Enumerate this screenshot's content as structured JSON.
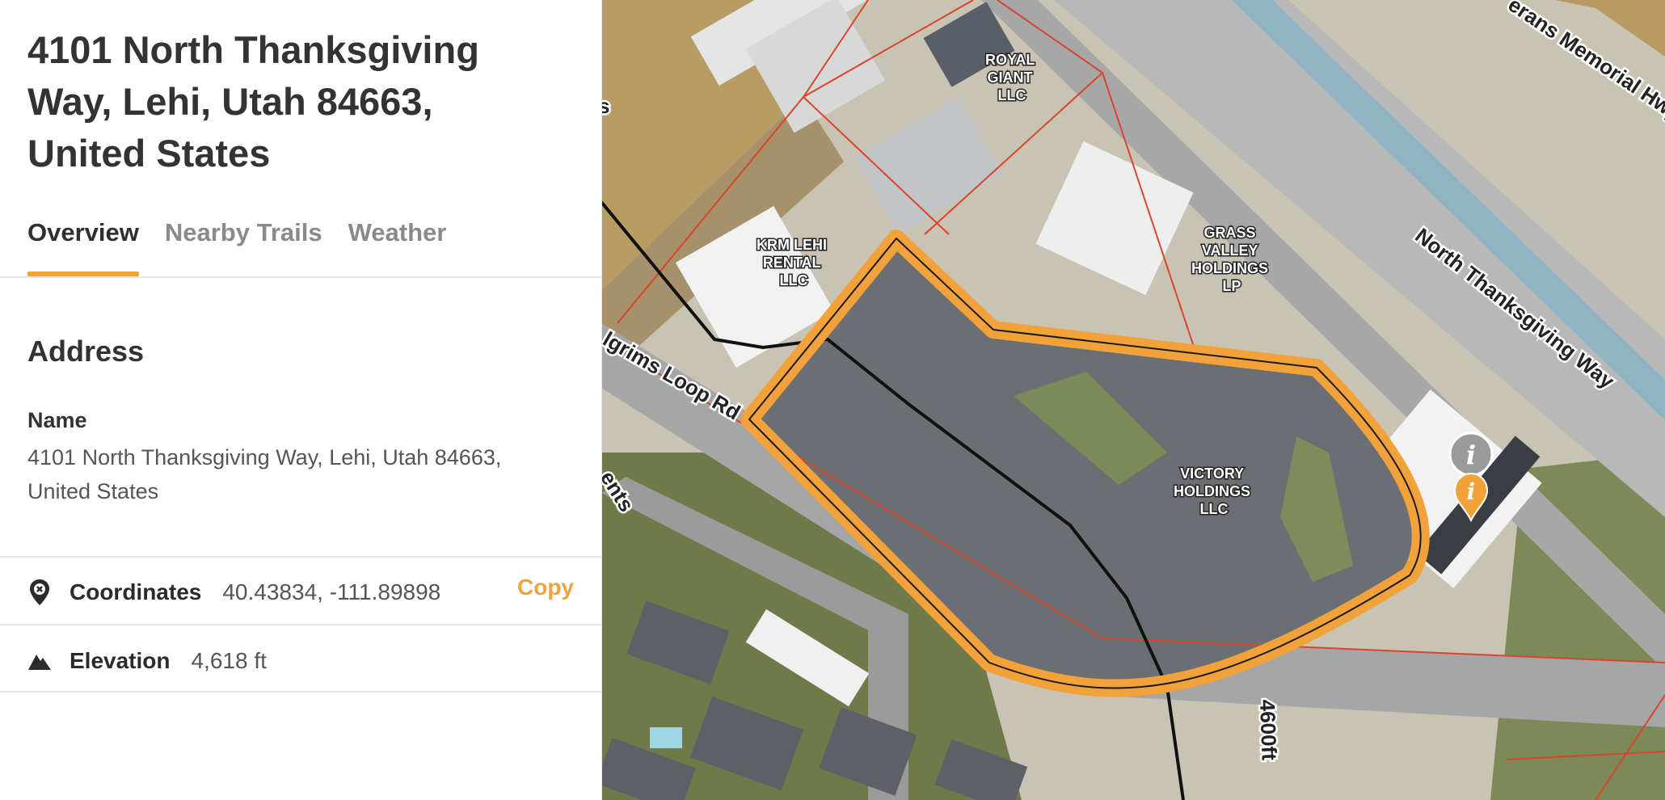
{
  "place": {
    "title": "4101 North Thanksgiving Way, Lehi, Utah 84663, United States"
  },
  "tabs": [
    {
      "label": "Overview",
      "active": true
    },
    {
      "label": "Nearby Trails",
      "active": false
    },
    {
      "label": "Weather",
      "active": false
    }
  ],
  "address": {
    "heading": "Address",
    "name_label": "Name",
    "name_value": "4101 North Thanksgiving Way, Lehi, Utah 84663, United States"
  },
  "coordinates": {
    "label": "Coordinates",
    "value": "40.43834, -111.89898",
    "copy_label": "Copy"
  },
  "elevation": {
    "label": "Elevation",
    "value": "4,618 ft"
  },
  "map": {
    "parcels": [
      {
        "lines": [
          "ROYAL",
          "GIANT",
          "LLC"
        ]
      },
      {
        "lines": [
          "KRM LEHI",
          "RENTAL",
          "LLC"
        ]
      },
      {
        "lines": [
          "GRASS",
          "VALLEY",
          "HOLDINGS",
          "LP"
        ]
      },
      {
        "lines": [
          "VICTORY",
          "HOLDINGS",
          "LLC"
        ]
      }
    ],
    "roads": {
      "veterans": "erans Memorial Hwy",
      "thanksgiving": "North Thanksgiving Way",
      "pilgrims": "lgrims Loop Rd",
      "ents": "ents",
      "contour": "4600ft",
      "edge_letter": "s"
    },
    "icons": [
      "info-pin-gray",
      "info-pin-orange"
    ],
    "colors": {
      "highlight": "#f2a23a",
      "parcel_line": "#d9452b",
      "accent": "#f2a23a"
    }
  }
}
